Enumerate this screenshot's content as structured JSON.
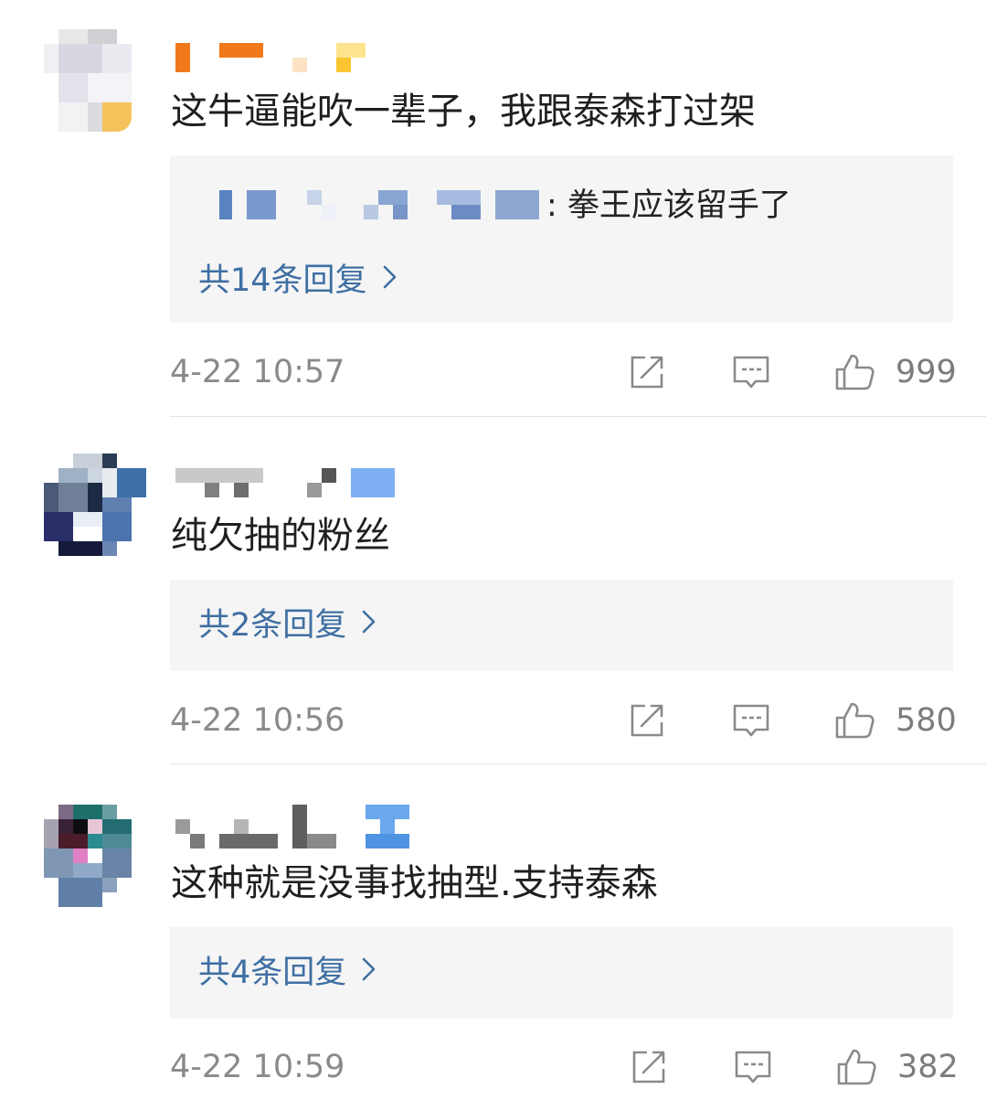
{
  "comments": [
    {
      "text": "这牛逼能吹一辈子，我跟泰森打过架",
      "reply_preview": "拳王应该留手了",
      "reply_count_label": "共14条回复",
      "time": "4-22 10:57",
      "likes": "999"
    },
    {
      "text": "纯欠抽的粉丝",
      "reply_count_label": "共2条回复",
      "time": "4-22 10:56",
      "likes": "580"
    },
    {
      "text": "这种就是没事找抽型.支持泰森",
      "reply_count_label": "共4条回复",
      "time": "4-22 10:59",
      "likes": "382"
    }
  ],
  "icons": [
    "share-icon",
    "comment-icon",
    "like-icon",
    "chevron-right-icon"
  ],
  "colors": {
    "link": "#3f6fa3",
    "meta": "#8a8a8a",
    "reply_bg": "#f5f5f5",
    "divider": "#e5e5e5"
  }
}
